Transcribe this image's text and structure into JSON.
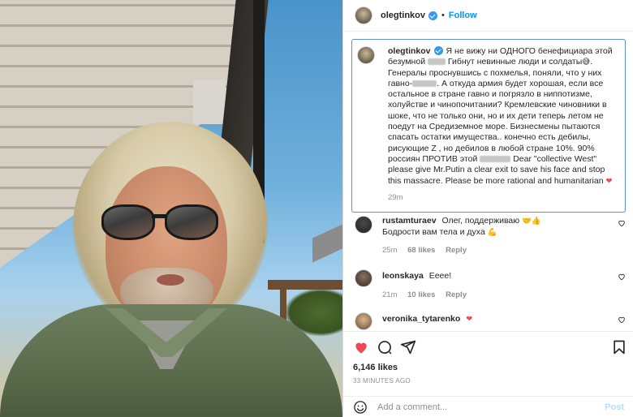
{
  "post": {
    "username": "olegtinkov",
    "follow_label": "Follow",
    "separator": "•"
  },
  "caption": {
    "username": "olegtinkov",
    "text_part1": "Я не вижу ни ОДНОГО бенефициара этой безумной ",
    "text_part2": " Гибнут невинные люди и солдаты",
    "text_part3": "Генералы проснувшись с похмелья, поняли, что у них гавно-",
    "text_part4": ". А откуда армия будет хорошая, если все остальное в стране гавно и погрязло в ниппотизме, холуйстве и чинопочитании? Кремлевские чиновники в шоке, что не только они, но и их дети теперь летом не поедут на Средиземное море. Бизнесмены пытаются спасать остатки имущества.. конечно есть дебилы, рисующие Z , но дебилов в любой стране 10%. 90% россиян ПРОТИВ этой",
    "text_part5": "Dear \"collective West\" please give Mr.Putin a clear exit to save his face and stop this massacre. Please be more rational and humanitarian",
    "time": "29m"
  },
  "comments": [
    {
      "username": "rustamturaev",
      "text": "Олег, поддерживаю",
      "text_line2": "Бодрости вам тела и духа",
      "time": "25m",
      "likes": "68 likes",
      "reply": "Reply"
    },
    {
      "username": "leonskaya",
      "text": "Eeee!",
      "time": "21m",
      "likes": "10 likes",
      "reply": "Reply"
    },
    {
      "username": "veronika_tytarenko",
      "text": ""
    }
  ],
  "actions": {
    "likes": "6,146 likes",
    "ago": "33 MINUTES AGO"
  },
  "add_comment": {
    "placeholder": "Add a comment...",
    "post_label": "Post"
  },
  "icons": [
    "verified-icon",
    "heart-icon",
    "comment-icon",
    "share-icon",
    "bookmark-icon",
    "smile-icon"
  ],
  "colors": {
    "accent": "#0095f6",
    "verified": "#3897f0",
    "heart": "#ed4956",
    "caption_border": "#5b8fd6"
  }
}
